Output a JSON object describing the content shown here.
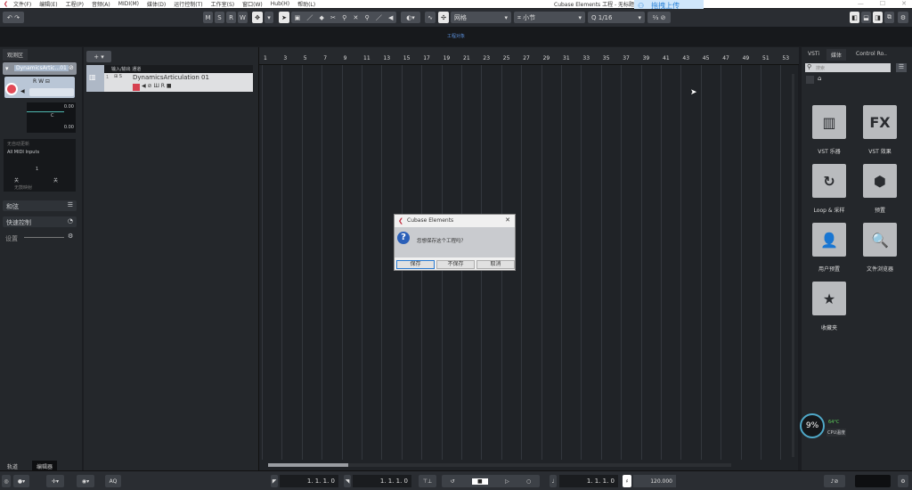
{
  "menu": [
    "文件(F)",
    "编辑(E)",
    "工程(P)",
    "音频(A)",
    "MIDI(M)",
    "媒体(D)",
    "运行控制(T)",
    "工作室(S)",
    "窗口(W)",
    "Hub(H)",
    "帮助(L)"
  ],
  "window_title": "Cubase Elements 工程 - 无标题1",
  "upload_label": "拖拽上传",
  "toolbar": {
    "m": "M",
    "s": "S",
    "r": "R",
    "w": "W",
    "snap_type": "网格",
    "grid": "小节",
    "quantize": "1/16"
  },
  "info_line": "工程对象",
  "inspector": {
    "tab": "观测区",
    "track_name": "DynamicsArtic...01",
    "volume": "0.00",
    "pan": "C",
    "delay": "0.00",
    "input": "All MIDI Inputs",
    "output": "无自动更新",
    "channel": "1",
    "bank": "关",
    "program": "关",
    "drumkit": "无鼓映射",
    "sec_chords": "和弦",
    "sec_quick": "快速控制",
    "settings": "设置"
  },
  "tracks": {
    "folder": "输入/输出 通道",
    "track1": "DynamicsArticulation 01",
    "num": "1"
  },
  "bottom_tabs": [
    "轨道",
    "编辑器"
  ],
  "ruler": [
    "1",
    "3",
    "5",
    "7",
    "9",
    "11",
    "13",
    "15",
    "17",
    "19",
    "21",
    "23",
    "25",
    "27",
    "29",
    "31",
    "33",
    "35",
    "37",
    "39",
    "41",
    "43",
    "45",
    "47",
    "49",
    "51",
    "53"
  ],
  "right": {
    "tabs": [
      "VSTi",
      "媒体",
      "Control Ro.."
    ],
    "search_placeholder": "搜索",
    "tiles": [
      {
        "label": "VST 乐器",
        "glyph": "▥"
      },
      {
        "label": "VST 效果",
        "glyph": "FX"
      },
      {
        "label": "Loop & 采样",
        "glyph": "↻"
      },
      {
        "label": "预置",
        "glyph": "⬢"
      },
      {
        "label": "用户预置",
        "glyph": "👤"
      },
      {
        "label": "文件浏览器",
        "glyph": "🔍"
      },
      {
        "label": "收藏夹",
        "glyph": "★"
      }
    ],
    "cpu_pct": "9%",
    "cpu_temp": "64°C",
    "cpu_label": "CPU温度"
  },
  "dialog": {
    "title": "Cubase Elements",
    "message": "您想保存这个工程吗？",
    "save": "保存",
    "dont_save": "不保存",
    "cancel": "取消"
  },
  "transport": {
    "left_locator": "1. 1. 1.  0",
    "right_locator": "1. 1. 1.  0",
    "position": "1. 1. 1.  0",
    "tempo": "120.000",
    "aq": "AQ"
  }
}
